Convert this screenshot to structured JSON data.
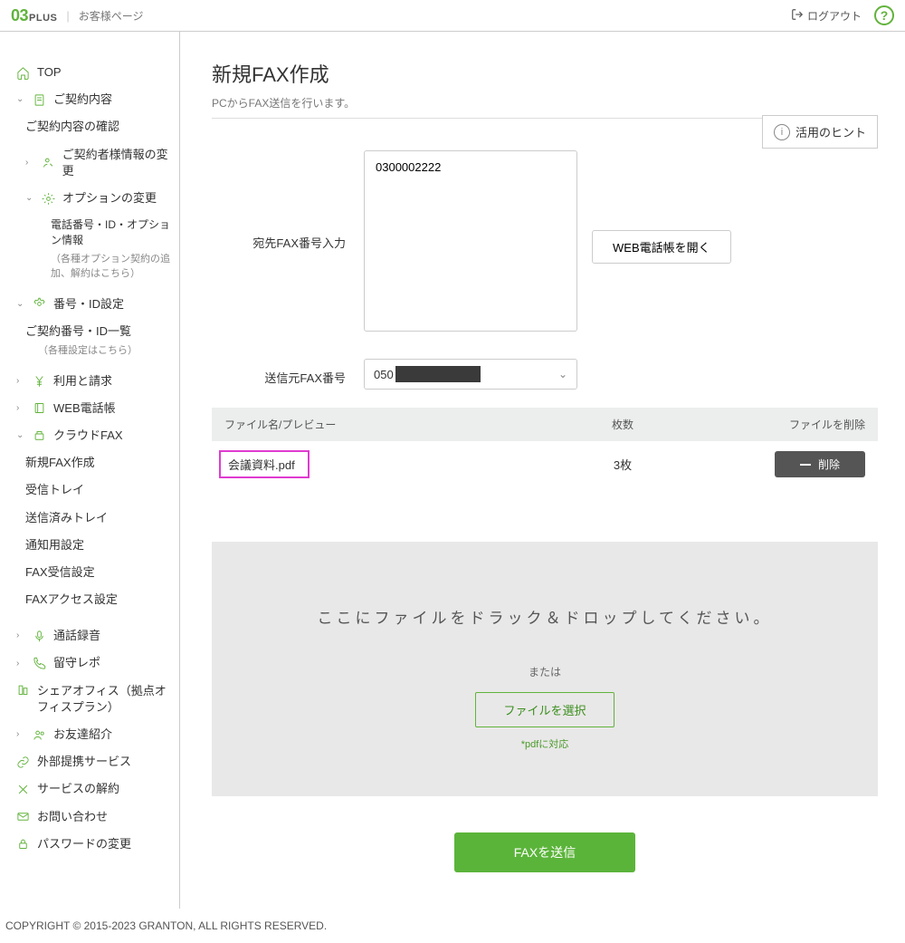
{
  "header": {
    "brand_o3": "03",
    "brand_plus": "PLUS",
    "page_label": "お客様ページ",
    "logout": "ログアウト",
    "help": "?"
  },
  "sidebar": {
    "top": "TOP",
    "contract": "ご契約内容",
    "contract_confirm": "ご契約内容の確認",
    "contract_user_change": "ご契約者様情報の変更",
    "option_change": "オプションの変更",
    "phone_id_option": "電話番号・ID・オプション情報",
    "phone_id_option_note": "（各種オプション契約の追加、解約はこちら）",
    "number_id": "番号・ID設定",
    "number_id_list": "ご契約番号・ID一覧",
    "number_id_list_note": "（各種設定はこちら）",
    "billing": "利用と請求",
    "web_phonebook": "WEB電話帳",
    "cloud_fax": "クラウドFAX",
    "fax_new": "新規FAX作成",
    "fax_inbox": "受信トレイ",
    "fax_sent": "送信済みトレイ",
    "fax_notify": "通知用設定",
    "fax_recv_setting": "FAX受信設定",
    "fax_access_setting": "FAXアクセス設定",
    "call_record": "通話録音",
    "voicemail": "留守レポ",
    "share_office": "シェアオフィス（拠点オフィスプラン）",
    "referral": "お友達紹介",
    "external_services": "外部提携サービス",
    "cancel_service": "サービスの解約",
    "contact": "お問い合わせ",
    "password_change": "パスワードの変更"
  },
  "main": {
    "title": "新規FAX作成",
    "subtitle": "PCからFAX送信を行います。",
    "hint_button": "活用のヒント",
    "dest_label": "宛先FAX番号入力",
    "dest_value": "0300002222",
    "open_phonebook": "WEB電話帳を開く",
    "sender_label": "送信元FAX番号",
    "sender_prefix": "050",
    "table": {
      "col_name": "ファイル名/プレビュー",
      "col_pages": "枚数",
      "col_delete": "ファイルを削除",
      "row": {
        "filename": "会議資料.pdf",
        "pages": "3枚",
        "delete_btn": "削除"
      }
    },
    "dropzone": {
      "text": "ここにファイルをドラック＆ドロップしてください。",
      "or": "または",
      "select_btn": "ファイルを選択",
      "note": "*pdfに対応"
    },
    "send_btn": "FAXを送信"
  },
  "footer": "COPYRIGHT © 2015-2023 GRANTON, ALL RIGHTS RESERVED."
}
